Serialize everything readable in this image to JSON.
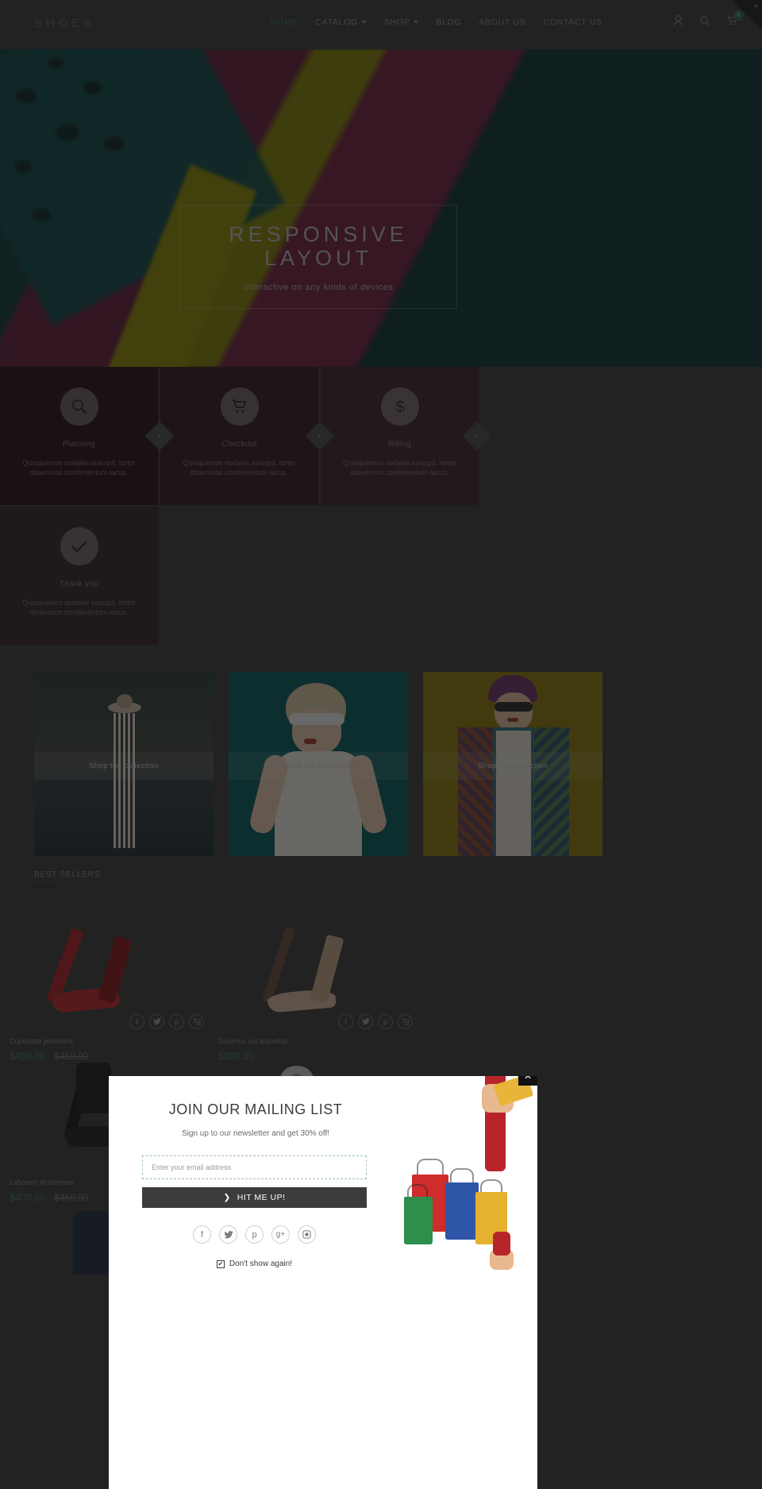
{
  "header": {
    "logo": "SHOES",
    "nav": [
      {
        "label": "HOME",
        "active": true,
        "caret": false
      },
      {
        "label": "CATALOG",
        "active": false,
        "caret": true
      },
      {
        "label": "SHOP",
        "active": false,
        "caret": true
      },
      {
        "label": "BLOG",
        "active": false,
        "caret": false
      },
      {
        "label": "ABOUT US",
        "active": false,
        "caret": false
      },
      {
        "label": "CONTACT US",
        "active": false,
        "caret": false
      }
    ],
    "icons": [
      "user-icon",
      "search-icon",
      "cart-icon"
    ],
    "cart_count": "0",
    "accent_color": "#3f7a6f"
  },
  "hero": {
    "title_line1": "RESPONSIVE",
    "title_line2": "LAYOUT",
    "subtitle": "Interactive on any kinds of devices"
  },
  "features": [
    {
      "icon": "search-icon",
      "title": "Planning",
      "desc_line1": "Quisquemos sodales suscipit, tortor",
      "desc_line2": "ditaemcos condimentum lacus."
    },
    {
      "icon": "cart-icon",
      "title": "Checkout",
      "desc_line1": "Quisquemos sodales suscipit, tortor",
      "desc_line2": "ditaemcos condimentum lacus."
    },
    {
      "icon": "dollar-icon",
      "title": "Billing",
      "desc_line1": "Quisquemos sodales suscipit, tortor",
      "desc_line2": "ditaemcos condimentum lacus."
    },
    {
      "icon": "check-icon",
      "title": "Thank you",
      "desc_line1": "Quisquemos sodales suscipit, tortor",
      "desc_line2": "ditaemcos condimentum lacus."
    }
  ],
  "feature_arrow": "›",
  "banners": [
    {
      "label": "Shop the collection"
    },
    {
      "label": "Shop the collection"
    },
    {
      "label": "Shop the collection"
    }
  ],
  "best_sellers": {
    "title": "BEST SELLERS"
  },
  "products": [
    {
      "name": "Cupiditate provident",
      "price": "$400.00",
      "old_price": "$450.00",
      "socials": [
        "facebook-icon",
        "twitter-icon",
        "pinterest-icon",
        "cart-icon"
      ]
    },
    {
      "name": "Ducimus qui blanditiis",
      "price": "$300.00",
      "old_price": "",
      "socials": [
        "facebook-icon",
        "twitter-icon",
        "pinterest-icon",
        "cart-icon"
      ]
    },
    {
      "name": "Laborum et dolorum",
      "price": "$400.00",
      "old_price": "$450.00",
      "socials": [
        "facebook-icon",
        "twitter-icon",
        "pinterest-icon",
        "cart-icon"
      ]
    },
    {
      "name": "",
      "price": "",
      "old_price": "",
      "socials": [
        "facebook-icon",
        "twitter-icon",
        "pinterest-icon",
        "cart-icon"
      ]
    }
  ],
  "modal": {
    "close_label": "✕",
    "title": "JOIN OUR MAILING LIST",
    "subtitle": "Sign up to our newsletter and get 30% off!",
    "email_placeholder": "Enter your email address",
    "email_value": "",
    "button_label": "HIT ME UP!",
    "button_chevron": "❯",
    "socials": [
      "facebook-icon",
      "twitter-icon",
      "pinterest-icon",
      "google-plus-icon",
      "instagram-icon"
    ],
    "social_glyphs": [
      "f",
      "t",
      "p",
      "g+",
      "▣"
    ],
    "checkbox_label": "Don't show again!",
    "checkbox_checked": true
  }
}
